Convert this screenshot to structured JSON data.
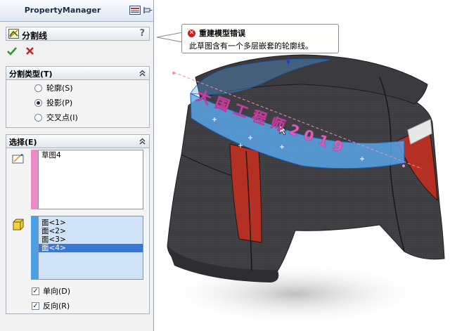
{
  "property_manager": {
    "title": "PropertyManager",
    "feature_name": "分割线",
    "help_glyph": "?",
    "split_type": {
      "header": "分割类型(T)",
      "options": [
        "轮廓(S)",
        "投影(P)",
        "交叉点(I)"
      ],
      "selected": "投影(P)"
    },
    "selection": {
      "header": "选择(E)",
      "sketch_list": [
        "草图4"
      ],
      "face_list": [
        "面<1>",
        "面<2>",
        "面<3>",
        "面<4>"
      ],
      "selected_face": "面<4>",
      "single_direction": {
        "label": "单向(D)",
        "checked": true
      },
      "reverse_direction": {
        "label": "反向(R)",
        "checked": true
      }
    }
  },
  "tooltip": {
    "title": "重建模型错误",
    "message": "此草图含有一个多层嵌套的轮廓线。"
  },
  "viewport": {
    "sketch_text": "大国工程师2019"
  },
  "colors": {
    "accent_blue": "#3a78d8",
    "sketch_pink": "#f28cc8",
    "model_body": "#3f3e43",
    "model_red": "#b43022",
    "split_band": "#5aa8ec"
  }
}
